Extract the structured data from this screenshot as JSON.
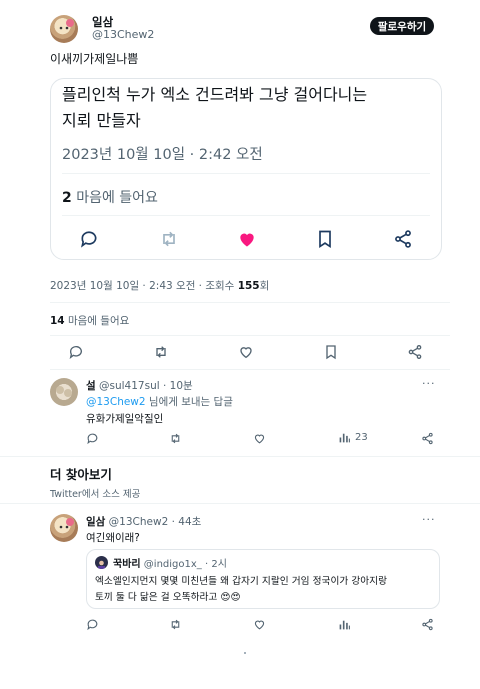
{
  "main_tweet": {
    "display_name": "일삼",
    "handle": "@13Chew2",
    "follow_label": "팔로우하기",
    "text": "이새끼가제일나쁨"
  },
  "quoted_card": {
    "text_line1": "플리인척 누가 엑소 건드려봐 그냥 걸어다니는",
    "text_line2": "지뢰 만들자",
    "timestamp": "2023년 10월 10일 · 2:42 오전",
    "likes_count": "2",
    "likes_label": "마음에 들어요"
  },
  "meta": {
    "timestamp": "2023년 10월 10일 · 2:43 오전 · 조회수",
    "views": "155",
    "views_unit": "회",
    "likes_count": "14",
    "likes_label": "마음에 들어요"
  },
  "reply": {
    "display_name": "설",
    "handle": "@sul417sul",
    "time": "· 10분",
    "reply_to_handle": "@13Chew2",
    "reply_to_suffix": " 님에게 보내는 답글",
    "text": "유화가제일악질인",
    "views": "23"
  },
  "more_section": {
    "title": "더 찾아보기",
    "subtitle": "Twitter에서 소스 제공"
  },
  "bottom_tweet": {
    "display_name": "일삼",
    "handle": "@13Chew2",
    "time": "· 44초",
    "text": "여긴왜이래?",
    "quote": {
      "display_name": "꾹바리",
      "handle": "@indigo1x_",
      "time": "· 2시",
      "text_line1": "엑소엘인지먼지 몇몇 미친년들 왜 갑자기 지랄인 거임 정국이가 강아지랑",
      "text_line2": "토끼 둘 다 닮은 걸 오똑하라고 😍😍"
    }
  },
  "colors": {
    "like_active": "#f91880",
    "muted": "#536471",
    "link": "#1d9bf0"
  }
}
